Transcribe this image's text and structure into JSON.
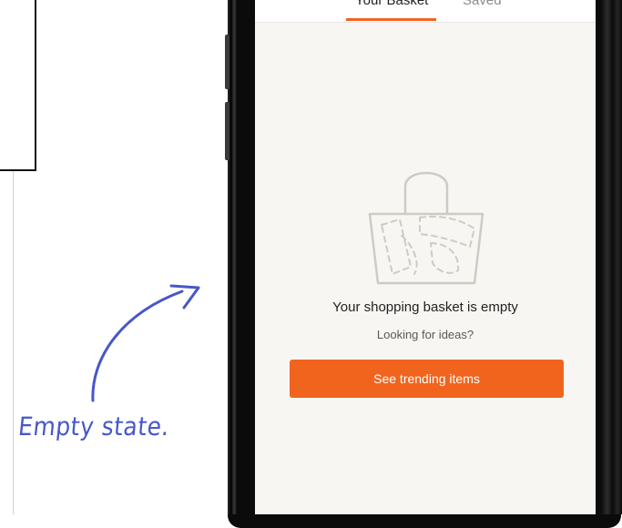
{
  "annotation": {
    "label": "Empty state.",
    "color": "#4757c9"
  },
  "tabs": [
    {
      "label": "Your Basket",
      "active": true
    },
    {
      "label": "Saved",
      "active": false
    }
  ],
  "empty_state": {
    "illustration": "basket-icon",
    "title": "Your shopping basket is empty",
    "subtitle": "Looking for ideas?",
    "button_label": "See trending items"
  },
  "colors": {
    "accent": "#f1641e",
    "screen_background": "#f7f6f3",
    "phone_frame": "#0b0b0b"
  }
}
